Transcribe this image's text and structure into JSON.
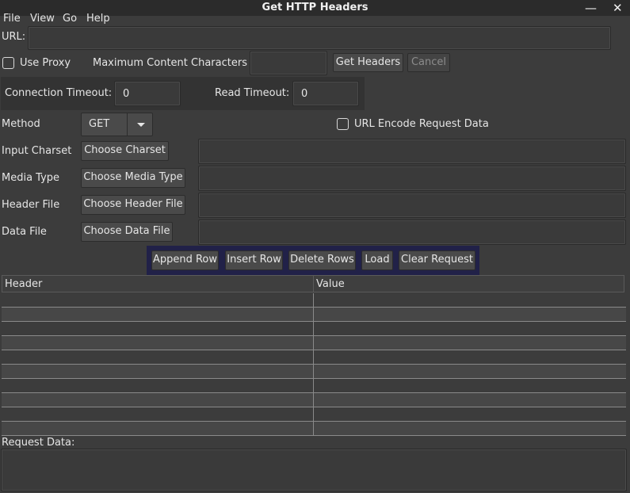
{
  "window": {
    "title": "Get HTTP Headers",
    "minimize_glyph": "—",
    "close_glyph": "✕"
  },
  "menu": {
    "items": [
      "File",
      "View",
      "Go",
      "Help"
    ]
  },
  "url": {
    "label": "URL:",
    "value": ""
  },
  "proxy": {
    "use_proxy_label": "Use Proxy",
    "use_proxy_checked": false,
    "max_chars_label": "Maximum Content Characters",
    "max_chars_value": "",
    "get_headers_label": "Get Headers",
    "cancel_label": "Cancel"
  },
  "timeouts": {
    "connection_label": "Connection Timeout:",
    "connection_value": "0",
    "read_label": "Read Timeout:",
    "read_value": "0"
  },
  "method": {
    "label": "Method",
    "selected": "GET",
    "url_encode_label": "URL Encode Request Data",
    "url_encode_checked": false
  },
  "charset": {
    "label": "Input Charset",
    "button_label": "Choose Charset",
    "value": ""
  },
  "media_type": {
    "label": "Media Type",
    "button_label": "Choose Media Type",
    "value": ""
  },
  "header_file": {
    "label": "Header File",
    "button_label": "Choose Header File",
    "value": ""
  },
  "data_file": {
    "label": "Data File",
    "button_label": "Choose Data File",
    "value": ""
  },
  "row_actions": {
    "append_label": "Append Row",
    "insert_label": "Insert Row",
    "delete_label": "Delete Rows",
    "load_label": "Load",
    "clear_label": "Clear Request"
  },
  "headers_table": {
    "columns": [
      "Header",
      "Value"
    ],
    "rows": [
      [
        "",
        ""
      ],
      [
        "",
        ""
      ],
      [
        "",
        ""
      ],
      [
        "",
        ""
      ],
      [
        "",
        ""
      ],
      [
        "",
        ""
      ],
      [
        "",
        ""
      ],
      [
        "",
        ""
      ],
      [
        "",
        ""
      ],
      [
        "",
        ""
      ]
    ]
  },
  "request_data": {
    "label": "Request Data:",
    "value": ""
  },
  "colors": {
    "background": "#3c3c3c",
    "button_bar": "#212148",
    "text": "#e6e6e6"
  }
}
